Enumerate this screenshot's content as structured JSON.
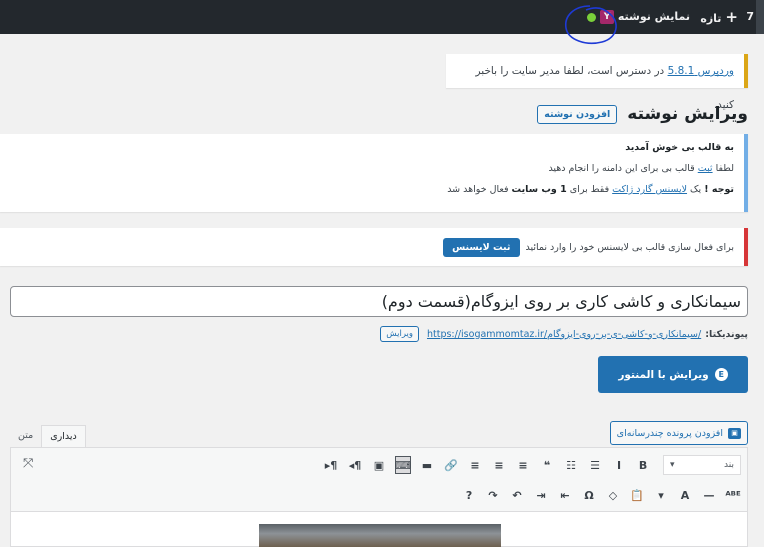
{
  "adminbar": {
    "count": "7",
    "new_label": "تازه",
    "view_post": "نمایش نوشته",
    "yoast_label": "Y"
  },
  "update_nag": {
    "link": "وردپرس 5.8.1",
    "text": " در دسترس است، لطفا مدیر سایت را باخبر کنید."
  },
  "page": {
    "title": "ویرایش نوشته",
    "add_new": "افزودن نوشته"
  },
  "welcome_notice": {
    "heading": "به قالب بی خوش آمدید",
    "line2_prefix": "لطفا ",
    "line2_link": "ثبت",
    "line2_suffix": " قالب بی برای این دامنه را انجام دهید",
    "line3_note": "توجه !",
    "line3_part1": " یک ",
    "line3_link": "لایسنس گارد ژاکت",
    "line3_part2": " فقط برای ",
    "line3_bold": "1 وب سایت",
    "line3_part3": " فعال خواهد شد"
  },
  "license_notice": {
    "text": "برای فعال سازی قالب بی لایسنس خود را وارد نمائید",
    "button": "ثبت لایسنس"
  },
  "post": {
    "title": "سیمانکاری و کاشی کاری بر روی ایزوگام(قسمت دوم)",
    "permalink_label": "پیوندیکتا:",
    "permalink_url": "https://isogammomtaz.ir/سیمانکاری-و-کاشی-ی-بر-روی-ایزوگام/",
    "permalink_edit": "ویرایش"
  },
  "elementor": {
    "label": "ویرایش با المنتور",
    "icon": "E"
  },
  "media": {
    "label": "افزودن پرونده چندرسانه‌ای"
  },
  "editor": {
    "tab_visual": "دیداری",
    "tab_text": "متن",
    "format_select": "بند",
    "toolbar_row1": [
      "B",
      "I",
      "☰",
      "☷",
      "❝",
      "≡",
      "≡",
      "≡",
      "🔗",
      "▬",
      "⌨",
      "▣",
      "¶◂",
      "¶▸"
    ],
    "toolbar_row2": [
      "ᴬᴮᴱ",
      "—",
      "A",
      "▾",
      "📋",
      "◇",
      "Ω",
      "⇤",
      "⇥",
      "↶",
      "↷",
      "?"
    ]
  }
}
